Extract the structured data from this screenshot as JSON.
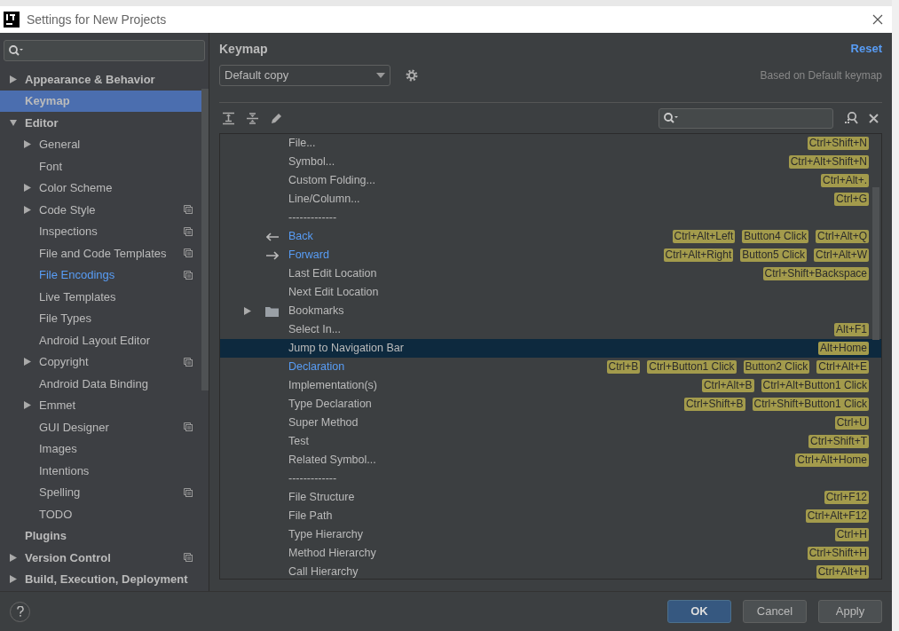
{
  "window": {
    "title": "Settings for New Projects"
  },
  "sidebar": {
    "items": [
      {
        "label": "Appearance & Behavior",
        "expanded": false,
        "selected": false
      },
      {
        "label": "Keymap",
        "selected": true
      },
      {
        "label": "Editor",
        "expanded": true,
        "selected": false,
        "children": [
          {
            "label": "General",
            "expanded": false,
            "selected": false
          },
          {
            "label": "Font",
            "selected": false
          },
          {
            "label": "Color Scheme",
            "expanded": false,
            "selected": false
          },
          {
            "label": "Code Style",
            "expanded": false,
            "selected": false,
            "project_scoped": true
          },
          {
            "label": "Inspections",
            "selected": false,
            "project_scoped": true
          },
          {
            "label": "File and Code Templates",
            "selected": false,
            "project_scoped": true
          },
          {
            "label": "File Encodings",
            "selected": false,
            "project_scoped": true,
            "modified": true
          },
          {
            "label": "Live Templates",
            "selected": false
          },
          {
            "label": "File Types",
            "selected": false
          },
          {
            "label": "Android Layout Editor",
            "selected": false
          },
          {
            "label": "Copyright",
            "expanded": false,
            "selected": false,
            "project_scoped": true
          },
          {
            "label": "Android Data Binding",
            "selected": false
          },
          {
            "label": "Emmet",
            "expanded": false,
            "selected": false
          },
          {
            "label": "GUI Designer",
            "selected": false,
            "project_scoped": true
          },
          {
            "label": "Images",
            "selected": false
          },
          {
            "label": "Intentions",
            "selected": false
          },
          {
            "label": "Spelling",
            "selected": false,
            "project_scoped": true
          },
          {
            "label": "TODO",
            "selected": false
          }
        ]
      },
      {
        "label": "Plugins",
        "selected": false
      },
      {
        "label": "Version Control",
        "expanded": false,
        "selected": false,
        "project_scoped": true
      },
      {
        "label": "Build, Execution, Deployment",
        "expanded": false,
        "selected": false
      }
    ]
  },
  "keymap": {
    "title": "Keymap",
    "reset": "Reset",
    "scheme": "Default copy",
    "based_on": "Based on Default keymap",
    "actions": [
      {
        "label": "File...",
        "shortcuts": [
          "Ctrl+Shift+N"
        ],
        "selected": false
      },
      {
        "label": "Symbol...",
        "shortcuts": [
          "Ctrl+Alt+Shift+N"
        ],
        "selected": false
      },
      {
        "label": "Custom Folding...",
        "shortcuts": [
          "Ctrl+Alt+."
        ],
        "selected": false
      },
      {
        "label": "Line/Column...",
        "shortcuts": [
          "Ctrl+G"
        ],
        "selected": false
      },
      {
        "label": "-------------",
        "selected": false
      },
      {
        "label": "Back",
        "kind": "back",
        "modified": true,
        "shortcuts": [
          "Ctrl+Alt+Left",
          "Button4 Click",
          "Ctrl+Alt+Q"
        ],
        "selected": false
      },
      {
        "label": "Forward",
        "kind": "forward",
        "modified": true,
        "shortcuts": [
          "Ctrl+Alt+Right",
          "Button5 Click",
          "Ctrl+Alt+W"
        ],
        "selected": false
      },
      {
        "label": "Last Edit Location",
        "shortcuts": [
          "Ctrl+Shift+Backspace"
        ],
        "selected": false
      },
      {
        "label": "Next Edit Location",
        "selected": false
      },
      {
        "label": "Bookmarks",
        "kind": "group",
        "expanded": false,
        "selected": false
      },
      {
        "label": "Select In...",
        "shortcuts": [
          "Alt+F1"
        ],
        "selected": false
      },
      {
        "label": "Jump to Navigation Bar",
        "shortcuts": [
          "Alt+Home"
        ],
        "selected": true
      },
      {
        "label": "Declaration",
        "modified": true,
        "shortcuts": [
          "Ctrl+B",
          "Ctrl+Button1 Click",
          "Button2 Click",
          "Ctrl+Alt+E"
        ],
        "selected": false
      },
      {
        "label": "Implementation(s)",
        "shortcuts": [
          "Ctrl+Alt+B",
          "Ctrl+Alt+Button1 Click"
        ],
        "selected": false
      },
      {
        "label": "Type Declaration",
        "shortcuts": [
          "Ctrl+Shift+B",
          "Ctrl+Shift+Button1 Click"
        ],
        "selected": false
      },
      {
        "label": "Super Method",
        "shortcuts": [
          "Ctrl+U"
        ],
        "selected": false
      },
      {
        "label": "Test",
        "shortcuts": [
          "Ctrl+Shift+T"
        ],
        "selected": false
      },
      {
        "label": "Related Symbol...",
        "shortcuts": [
          "Ctrl+Alt+Home"
        ],
        "selected": false
      },
      {
        "label": "-------------",
        "selected": false
      },
      {
        "label": "File Structure",
        "shortcuts": [
          "Ctrl+F12"
        ],
        "selected": false
      },
      {
        "label": "File Path",
        "shortcuts": [
          "Ctrl+Alt+F12"
        ],
        "selected": false
      },
      {
        "label": "Type Hierarchy",
        "shortcuts": [
          "Ctrl+H"
        ],
        "selected": false
      },
      {
        "label": "Method Hierarchy",
        "shortcuts": [
          "Ctrl+Shift+H"
        ],
        "selected": false
      },
      {
        "label": "Call Hierarchy",
        "shortcuts": [
          "Ctrl+Alt+H"
        ],
        "selected": false
      }
    ]
  },
  "buttons": [
    {
      "label": "OK",
      "kind": "primary"
    },
    {
      "label": "Cancel",
      "kind": "normal"
    },
    {
      "label": "Apply",
      "kind": "normal"
    }
  ]
}
